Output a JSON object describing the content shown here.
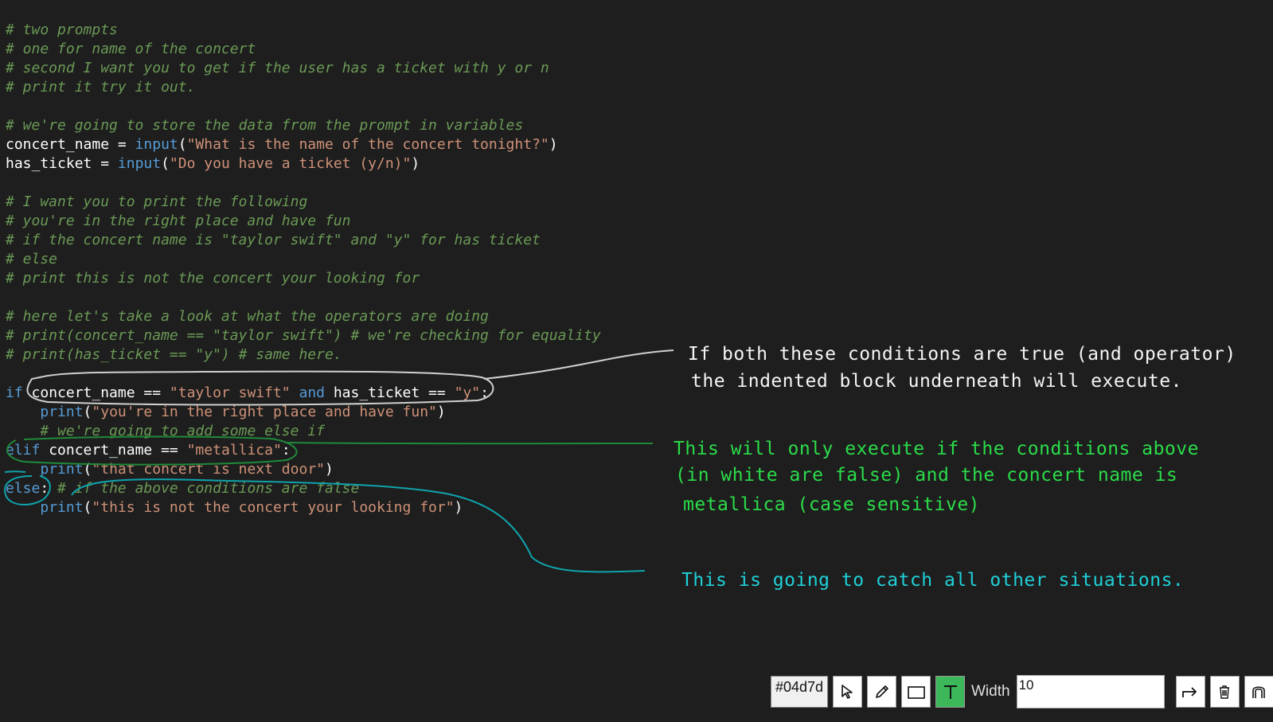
{
  "code_lines": [
    {
      "parts": [
        {
          "t": "# two prompts",
          "c": "cm"
        }
      ]
    },
    {
      "parts": [
        {
          "t": "# one for name of the concert",
          "c": "cm"
        }
      ]
    },
    {
      "parts": [
        {
          "t": "# second I want you to get if the user has a ticket with y or n",
          "c": "cm"
        }
      ]
    },
    {
      "parts": [
        {
          "t": "# print it try it out.",
          "c": "cm"
        }
      ]
    },
    {
      "parts": []
    },
    {
      "parts": [
        {
          "t": "# we're going to store the data from the prompt in variables",
          "c": "cm"
        }
      ]
    },
    {
      "parts": [
        {
          "t": "concert_name = ",
          "c": "pl"
        },
        {
          "t": "input",
          "c": "fn"
        },
        {
          "t": "(",
          "c": "pl"
        },
        {
          "t": "\"What is the name of the concert tonight?\"",
          "c": "st"
        },
        {
          "t": ")",
          "c": "pl"
        }
      ]
    },
    {
      "parts": [
        {
          "t": "has_ticket = ",
          "c": "pl"
        },
        {
          "t": "input",
          "c": "fn"
        },
        {
          "t": "(",
          "c": "pl"
        },
        {
          "t": "\"Do you have a ticket (y/n)\"",
          "c": "st"
        },
        {
          "t": ")",
          "c": "pl"
        }
      ]
    },
    {
      "parts": []
    },
    {
      "parts": [
        {
          "t": "# I want you to print the following",
          "c": "cm"
        }
      ]
    },
    {
      "parts": [
        {
          "t": "# you're in the right place and have fun",
          "c": "cm"
        }
      ]
    },
    {
      "parts": [
        {
          "t": "# if the concert name is \"taylor swift\" and \"y\" for has ticket",
          "c": "cm"
        }
      ]
    },
    {
      "parts": [
        {
          "t": "# else",
          "c": "cm"
        }
      ]
    },
    {
      "parts": [
        {
          "t": "# print this is not the concert your looking for",
          "c": "cm"
        }
      ]
    },
    {
      "parts": []
    },
    {
      "parts": [
        {
          "t": "# here let's take a look at what the operators are doing",
          "c": "cm"
        }
      ]
    },
    {
      "parts": [
        {
          "t": "# print(concert_name == \"taylor swift\") # we're checking for equality",
          "c": "cm"
        }
      ]
    },
    {
      "parts": [
        {
          "t": "# print(has_ticket == \"y\") # same here.",
          "c": "cm"
        }
      ]
    },
    {
      "parts": []
    },
    {
      "parts": [
        {
          "t": "if",
          "c": "kw"
        },
        {
          "t": " concert_name == ",
          "c": "pl"
        },
        {
          "t": "\"taylor swift\"",
          "c": "st"
        },
        {
          "t": " ",
          "c": "pl"
        },
        {
          "t": "and",
          "c": "kw"
        },
        {
          "t": " has_ticket == ",
          "c": "pl"
        },
        {
          "t": "\"y\"",
          "c": "st"
        },
        {
          "t": ":",
          "c": "pl"
        }
      ]
    },
    {
      "parts": [
        {
          "t": "    ",
          "c": "pl"
        },
        {
          "t": "print",
          "c": "fn"
        },
        {
          "t": "(",
          "c": "pl"
        },
        {
          "t": "\"you're in the right place and have fun\"",
          "c": "st"
        },
        {
          "t": ")",
          "c": "pl"
        }
      ]
    },
    {
      "parts": [
        {
          "t": "    ",
          "c": "pl"
        },
        {
          "t": "# we're going to add some else if",
          "c": "cm"
        }
      ]
    },
    {
      "parts": [
        {
          "t": "elif",
          "c": "kw"
        },
        {
          "t": " concert_name == ",
          "c": "pl"
        },
        {
          "t": "\"metallica\"",
          "c": "st"
        },
        {
          "t": ":",
          "c": "pl"
        }
      ]
    },
    {
      "parts": [
        {
          "t": "    ",
          "c": "pl"
        },
        {
          "t": "print",
          "c": "fn"
        },
        {
          "t": "(",
          "c": "pl"
        },
        {
          "t": "\"that concert is next door\"",
          "c": "st"
        },
        {
          "t": ")",
          "c": "pl"
        }
      ]
    },
    {
      "parts": [
        {
          "t": "else",
          "c": "kw"
        },
        {
          "t": ": ",
          "c": "pl"
        },
        {
          "t": "# if the above conditions are false",
          "c": "cm"
        }
      ]
    },
    {
      "parts": [
        {
          "t": "    ",
          "c": "pl"
        },
        {
          "t": "print",
          "c": "fn"
        },
        {
          "t": "(",
          "c": "pl"
        },
        {
          "t": "\"this is not the concert your looking for\"",
          "c": "st"
        },
        {
          "t": ")",
          "c": "pl"
        }
      ]
    }
  ],
  "annotations": {
    "white_line1": "If both these conditions are true (and operator)",
    "white_line2": "the indented block underneath will execute.",
    "green_line1": "This will only execute if the conditions above",
    "green_line2": "(in white are false) and the concert name is",
    "green_line3": "metallica (case sensitive)",
    "cyan_line1": "This is going to catch all other situations."
  },
  "colors": {
    "white_ink": "#d0d0d0",
    "green_ink": "#1f8a3a",
    "cyan_ink": "#0fa3ab"
  },
  "toolbar": {
    "color_value": "#04d7d",
    "width_label": "Width",
    "width_value": "10",
    "tools": [
      "select-tool",
      "pen-tool",
      "rectangle-tool",
      "text-tool",
      "redo",
      "delete",
      "clear"
    ],
    "active_tool": "text-tool"
  }
}
